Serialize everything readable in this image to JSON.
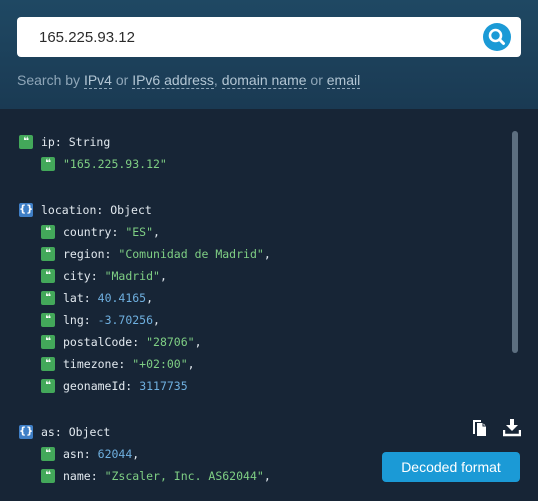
{
  "search": {
    "value": "165.225.93.12",
    "help_prefix": "Search by ",
    "help_ipv4": "IPv4",
    "help_or1": " or ",
    "help_ipv6": "IPv6 address",
    "help_comma": ", ",
    "help_domain": "domain name",
    "help_or2": " or ",
    "help_email": "email"
  },
  "tree": {
    "ip": {
      "key": "ip:",
      "type": "String",
      "value": "\"165.225.93.12\""
    },
    "location": {
      "key": "location:",
      "type": "Object",
      "fields": [
        {
          "key": "country:",
          "value": "\"ES\"",
          "kind": "string",
          "sep": ","
        },
        {
          "key": "region:",
          "value": "\"Comunidad de Madrid\"",
          "kind": "string",
          "sep": ","
        },
        {
          "key": "city:",
          "value": "\"Madrid\"",
          "kind": "string",
          "sep": ","
        },
        {
          "key": "lat:",
          "value": "40.4165",
          "kind": "number",
          "sep": ","
        },
        {
          "key": "lng:",
          "value": "-3.70256",
          "kind": "number",
          "sep": ","
        },
        {
          "key": "postalCode:",
          "value": "\"28706\"",
          "kind": "string",
          "sep": ","
        },
        {
          "key": "timezone:",
          "value": "\"+02:00\"",
          "kind": "string",
          "sep": ","
        },
        {
          "key": "geonameId:",
          "value": "3117735",
          "kind": "number",
          "sep": ""
        }
      ]
    },
    "as": {
      "key": "as:",
      "type": "Object",
      "fields": [
        {
          "key": "asn:",
          "value": "62044",
          "kind": "number",
          "sep": ","
        },
        {
          "key": "name:",
          "value": "\"Zscaler, Inc. AS62044\"",
          "kind": "string",
          "sep": ","
        }
      ]
    }
  },
  "actions": {
    "decoded_label": "Decoded format",
    "copy_icon": "copy-icon",
    "download_icon": "download-icon"
  },
  "colors": {
    "accent": "#1b9ad6",
    "string_badge": "#43a85a",
    "object_badge": "#3f7fc6",
    "string_value": "#7fcf84",
    "number_value": "#6fb0e0"
  }
}
